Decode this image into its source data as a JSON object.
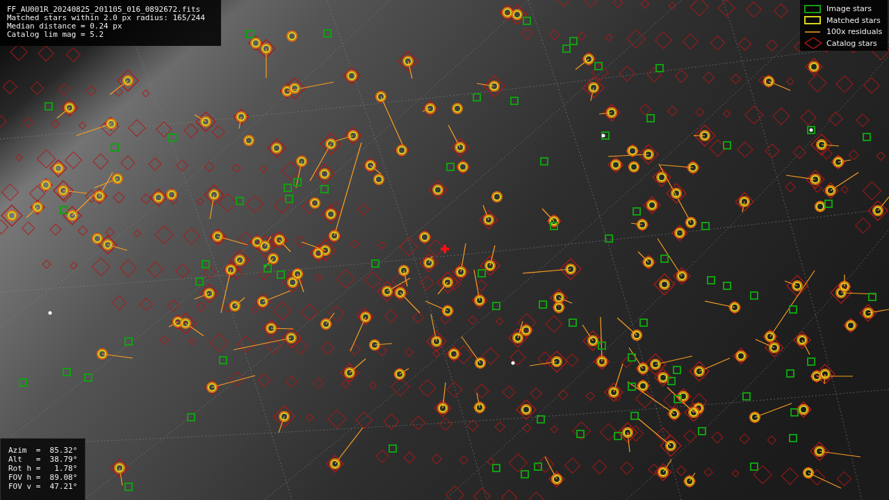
{
  "file_info": {
    "lines": [
      "FF_AU001R_20240825_201105_016_0892672.fits",
      "Matched stars within 2.0 px radius: 165/244",
      "Median distance = 0.24 px",
      "Catalog lim mag = 5.2"
    ]
  },
  "legend": {
    "items": [
      {
        "kind": "image",
        "label": "Image stars"
      },
      {
        "kind": "matched",
        "label": "Matched stars"
      },
      {
        "kind": "residual",
        "label": "100x residuals"
      },
      {
        "kind": "catalog",
        "label": "Catalog stars"
      }
    ]
  },
  "pointing": {
    "lines": [
      "Azim  =  85.32°",
      "Alt   =  38.79°",
      "Rot h =   1.78°",
      "FOV h =  89.08°",
      "FOV v =  47.21°"
    ]
  }
}
